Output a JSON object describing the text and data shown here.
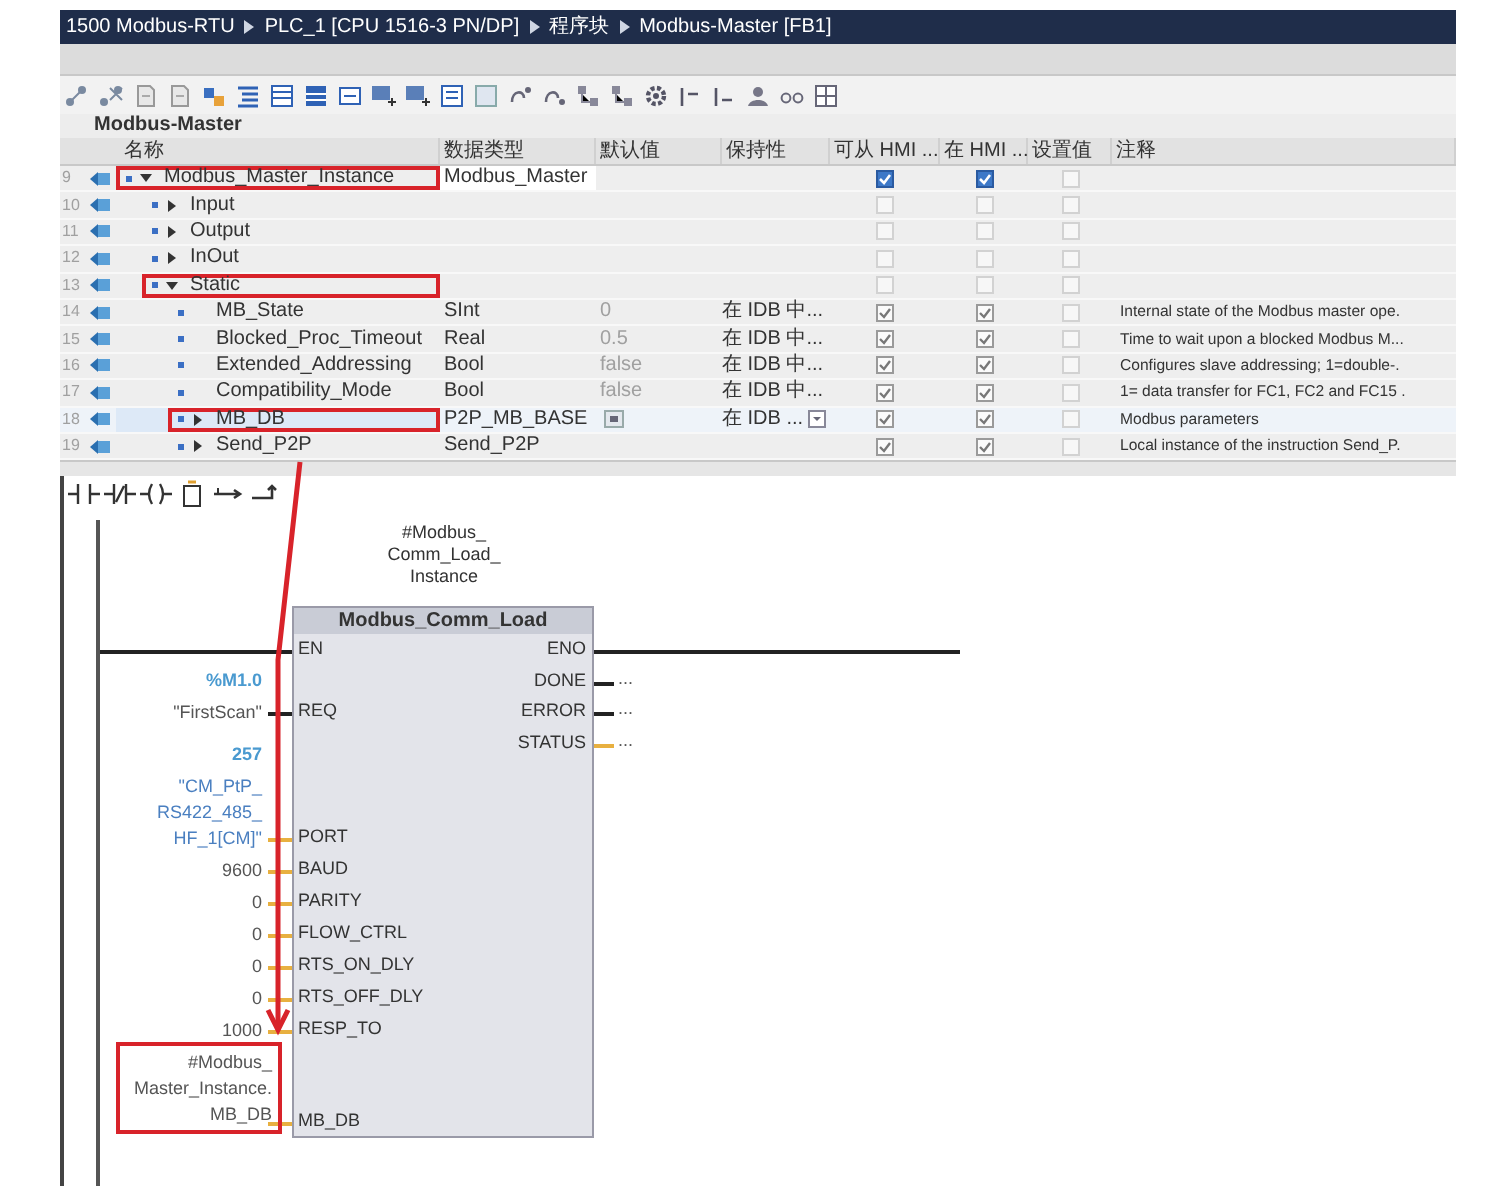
{
  "window": {
    "breadcrumb": [
      "1500 Modbus-RTU",
      "PLC_1 [CPU 1516-3 PN/DP]",
      "程序块",
      "Modbus-Master [FB1]"
    ]
  },
  "block_title": "Modbus-Master",
  "table": {
    "columns": [
      "名称",
      "数据类型",
      "默认值",
      "保持性",
      "可从 HMI ...",
      "在 HMI ...",
      "设置值",
      "注释"
    ],
    "rows": [
      {
        "number": "9",
        "name": "Modbus_Master_Instance",
        "kind": "struct",
        "expanded": true,
        "highlighted": true,
        "selected": false,
        "datatype": "Modbus_Master",
        "hmi_access": {
          "checked": true,
          "disabled": false
        },
        "hmi_visible": {
          "checked": true,
          "disabled": false
        },
        "setpoint": {
          "checked": false,
          "disabled": true
        },
        "children": [
          {
            "number": "10",
            "name": "Input",
            "kind": "struct",
            "expanded": false,
            "highlighted": false,
            "selected": false,
            "hmi_access": {
              "checked": false,
              "disabled": true
            },
            "hmi_visible": {
              "checked": false,
              "disabled": true
            },
            "setpoint": {
              "checked": false,
              "disabled": true
            }
          },
          {
            "number": "11",
            "name": "Output",
            "kind": "struct",
            "expanded": false,
            "highlighted": false,
            "selected": false,
            "hmi_access": {
              "checked": false,
              "disabled": true
            },
            "hmi_visible": {
              "checked": false,
              "disabled": true
            },
            "setpoint": {
              "checked": false,
              "disabled": true
            }
          },
          {
            "number": "12",
            "name": "InOut",
            "kind": "struct",
            "expanded": false,
            "highlighted": false,
            "selected": false,
            "hmi_access": {
              "checked": false,
              "disabled": true
            },
            "hmi_visible": {
              "checked": false,
              "disabled": true
            },
            "setpoint": {
              "checked": false,
              "disabled": true
            }
          },
          {
            "number": "13",
            "name": "Static",
            "kind": "struct",
            "expanded": true,
            "highlighted": true,
            "selected": false,
            "hmi_access": {
              "checked": false,
              "disabled": true
            },
            "hmi_visible": {
              "checked": false,
              "disabled": true
            },
            "setpoint": {
              "checked": false,
              "disabled": true
            },
            "children": [
              {
                "number": "14",
                "name": "MB_State",
                "kind": "member",
                "highlighted": false,
                "selected": false,
                "datatype": "SInt",
                "default": "0",
                "retain": "在 IDB 中...",
                "hmi_access": {
                  "checked": true,
                  "disabled": true
                },
                "hmi_visible": {
                  "checked": true,
                  "disabled": true
                },
                "setpoint": {
                  "checked": false,
                  "disabled": true
                },
                "comment": "Internal state of the Modbus master ope."
              },
              {
                "number": "15",
                "name": "Blocked_Proc_Timeout",
                "kind": "member",
                "highlighted": false,
                "selected": false,
                "datatype": "Real",
                "default": "0.5",
                "retain": "在 IDB 中...",
                "hmi_access": {
                  "checked": true,
                  "disabled": true
                },
                "hmi_visible": {
                  "checked": true,
                  "disabled": true
                },
                "setpoint": {
                  "checked": false,
                  "disabled": true
                },
                "comment": "Time to wait upon a blocked Modbus M..."
              },
              {
                "number": "16",
                "name": "Extended_Addressing",
                "kind": "member",
                "highlighted": false,
                "selected": false,
                "datatype": "Bool",
                "default": "false",
                "retain": "在 IDB 中...",
                "hmi_access": {
                  "checked": true,
                  "disabled": true
                },
                "hmi_visible": {
                  "checked": true,
                  "disabled": true
                },
                "setpoint": {
                  "checked": false,
                  "disabled": true
                },
                "comment": "Configures slave addressing; 1=double-."
              },
              {
                "number": "17",
                "name": "Compatibility_Mode",
                "kind": "member",
                "highlighted": false,
                "selected": false,
                "datatype": "Bool",
                "default": "false",
                "retain": "在 IDB 中...",
                "hmi_access": {
                  "checked": true,
                  "disabled": true
                },
                "hmi_visible": {
                  "checked": true,
                  "disabled": true
                },
                "setpoint": {
                  "checked": false,
                  "disabled": true
                },
                "comment": "1= data transfer for FC1, FC2 and FC15 ."
              },
              {
                "number": "18",
                "name": "MB_DB",
                "kind": "struct",
                "expanded": false,
                "highlighted": true,
                "selected": true,
                "datatype": "P2P_MB_BASE",
                "retain": "在 IDB ...",
                "hmi_access": {
                  "checked": true,
                  "disabled": true
                },
                "hmi_visible": {
                  "checked": true,
                  "disabled": true
                },
                "setpoint": {
                  "checked": false,
                  "disabled": true
                },
                "comment": "Modbus parameters"
              },
              {
                "number": "19",
                "name": "Send_P2P",
                "kind": "struct",
                "expanded": false,
                "highlighted": false,
                "selected": false,
                "datatype": "Send_P2P",
                "hmi_access": {
                  "checked": true,
                  "disabled": true
                },
                "hmi_visible": {
                  "checked": true,
                  "disabled": true
                },
                "setpoint": {
                  "checked": false,
                  "disabled": true
                },
                "comment": "Local instance of the instruction Send_P."
              }
            ]
          }
        ]
      }
    ]
  },
  "ladder": {
    "instance": "#Modbus_\nComm_Load_\nInstance",
    "block": {
      "title": "Modbus_Comm_Load",
      "inputs": [
        {
          "name": "EN",
          "kind": "enable"
        },
        {
          "name": "REQ",
          "kind": "bool",
          "address": "%M1.0",
          "actual": "\"FirstScan\"",
          "highlighted": false
        },
        {
          "name": "PORT",
          "kind": "value",
          "address": "257",
          "actual": "\"CM_PtP_\nRS422_485_\nHF_1[CM]\"",
          "highlighted": false
        },
        {
          "name": "BAUD",
          "kind": "value",
          "actual": "9600",
          "highlighted": false
        },
        {
          "name": "PARITY",
          "kind": "value",
          "actual": "0",
          "highlighted": false
        },
        {
          "name": "FLOW_CTRL",
          "kind": "value",
          "actual": "0",
          "highlighted": false
        },
        {
          "name": "RTS_ON_DLY",
          "kind": "value",
          "actual": "0",
          "highlighted": false
        },
        {
          "name": "RTS_OFF_DLY",
          "kind": "value",
          "actual": "0",
          "highlighted": false
        },
        {
          "name": "RESP_TO",
          "kind": "value",
          "actual": "1000",
          "highlighted": false
        },
        {
          "name": "MB_DB",
          "kind": "value",
          "actual": "#Modbus_\nMaster_Instance.\nMB_DB",
          "highlighted": true
        }
      ],
      "outputs": [
        {
          "name": "ENO",
          "kind": "enable"
        },
        {
          "name": "DONE",
          "kind": "bool",
          "actual": "..."
        },
        {
          "name": "ERROR",
          "kind": "bool",
          "actual": "..."
        },
        {
          "name": "STATUS",
          "kind": "value",
          "actual": "..."
        }
      ]
    }
  }
}
